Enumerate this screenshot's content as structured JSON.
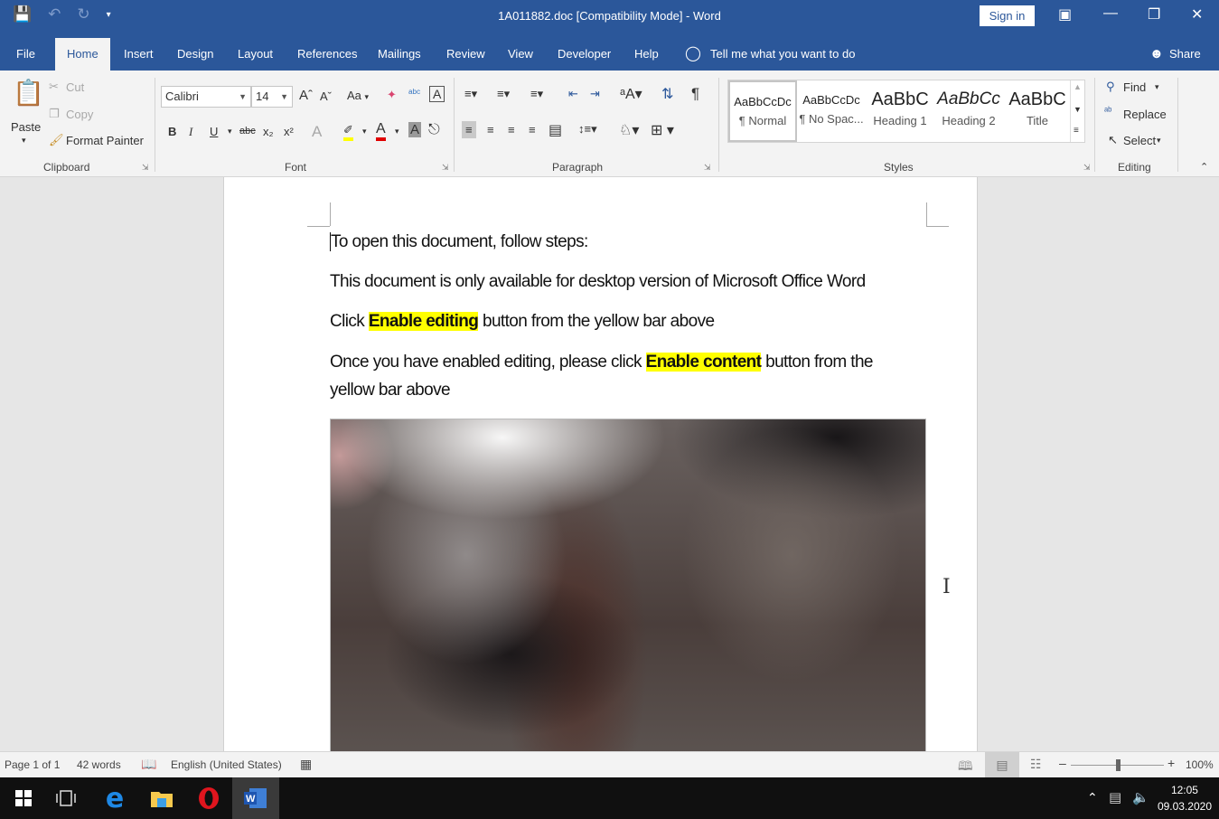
{
  "titlebar": {
    "title": "1A011882.doc [Compatibility Mode]  -  Word",
    "sign_in": "Sign in",
    "qat": {
      "save_icon": "save-icon",
      "undo_icon": "undo-icon",
      "redo_icon": "redo-icon",
      "customize_icon": "customize-qat-icon"
    },
    "window_controls": [
      "ribbon-display-options",
      "minimize",
      "restore",
      "close"
    ]
  },
  "tabs": [
    {
      "label": "File"
    },
    {
      "label": "Home",
      "active": true
    },
    {
      "label": "Insert"
    },
    {
      "label": "Design"
    },
    {
      "label": "Layout"
    },
    {
      "label": "References"
    },
    {
      "label": "Mailings"
    },
    {
      "label": "Review"
    },
    {
      "label": "View"
    },
    {
      "label": "Developer"
    },
    {
      "label": "Help"
    }
  ],
  "tell_me": "Tell me what you want to do",
  "share": "Share",
  "ribbon": {
    "clipboard": {
      "label": "Clipboard",
      "paste": "Paste",
      "cut": "Cut",
      "copy": "Copy",
      "format_painter": "Format Painter"
    },
    "font": {
      "label": "Font",
      "font_name": "Calibri",
      "font_size": "14",
      "change_case": "Aa"
    },
    "paragraph": {
      "label": "Paragraph"
    },
    "styles": {
      "label": "Styles",
      "items": [
        {
          "preview": "AaBbCcDc",
          "name": "¶ Normal",
          "selected": true
        },
        {
          "preview": "AaBbCcDc",
          "name": "¶ No Spac..."
        },
        {
          "preview": "AaBbC",
          "name": "Heading 1"
        },
        {
          "preview": "AaBbCc",
          "name": "Heading 2"
        },
        {
          "preview": "AaBbC",
          "name": "Title"
        }
      ]
    },
    "editing": {
      "label": "Editing",
      "find": "Find",
      "replace": "Replace",
      "select": "Select"
    }
  },
  "document": {
    "paragraphs": [
      {
        "text": "To open this document, follow steps:"
      },
      {
        "text": "This document is only available for desktop version of Microsoft Office Word"
      },
      {
        "before": "Click ",
        "highlight": "Enable editing",
        "after": " button from the yellow bar above"
      },
      {
        "before": "Once you have enabled editing, please click ",
        "highlight": "Enable content",
        "after": " button from the",
        "line2": "yellow bar above"
      }
    ],
    "highlight_color": "#ffff00"
  },
  "statusbar": {
    "page": "Page 1 of 1",
    "words": "42 words",
    "language": "English (United States)",
    "zoom": "100%",
    "zoom_value_percent": 100
  },
  "taskbar": {
    "apps": [
      "start",
      "task-view",
      "edge",
      "file-explorer",
      "opera",
      "word"
    ],
    "time": "12:05",
    "date": "09.03.2020"
  },
  "colors": {
    "word_blue": "#2b579a",
    "ribbon_bg": "#f3f3f3",
    "taskbar": "#101010"
  }
}
